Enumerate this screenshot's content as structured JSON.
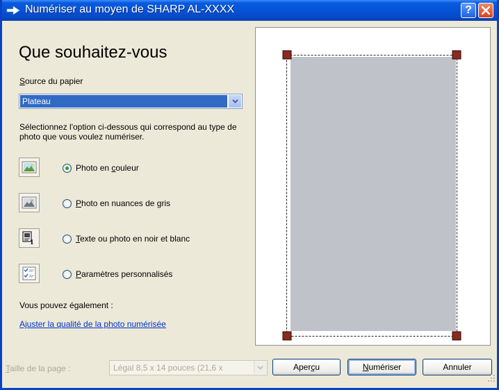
{
  "window": {
    "title": "Numériser au moyen de SHARP AL-XXXX",
    "help_label": "?"
  },
  "main": {
    "heading": "Que souhaitez-vous",
    "source": {
      "label_mnemonic": "S",
      "label_rest": "ource du papier",
      "selected": "Plateau"
    },
    "instructions": "Sélectionnez l'option ci-dessous qui correspond au type de photo que vous voulez numériser.",
    "options": [
      {
        "before": "Photo en ",
        "mnemonic": "c",
        "after": "ouleur",
        "icon": "color-photo-icon",
        "selected": true
      },
      {
        "before": "",
        "mnemonic": "P",
        "after": "hoto en nuances de gris",
        "icon": "grayscale-photo-icon",
        "selected": false
      },
      {
        "before": "",
        "mnemonic": "T",
        "after": "exte ou photo en noir et blanc",
        "icon": "black-white-text-icon",
        "selected": false
      },
      {
        "before": "",
        "mnemonic": "P",
        "after": "aramètres personnalisés",
        "icon": "custom-settings-icon",
        "selected": false
      }
    ],
    "also_label": "Vous pouvez également :",
    "quality_link": "Ajuster la qualité de la photo numérisée"
  },
  "bottom": {
    "page_size": {
      "label_mnemonic": "T",
      "label_rest": "aille de la page :",
      "value": "Légal 8,5 x 14 pouces (21,6 x"
    },
    "preview_button": {
      "before": "Aper",
      "mnemonic": "ç",
      "after": "u"
    },
    "scan_button": {
      "before": "",
      "mnemonic": "N",
      "after": "umériser"
    },
    "cancel_button": "Annuler"
  },
  "colors": {
    "titlebar": "#0553d6",
    "selection": "#316ac5",
    "preview_page": "#c0c2ca",
    "crop_handle": "#8b2a20",
    "link": "#0033cc"
  }
}
